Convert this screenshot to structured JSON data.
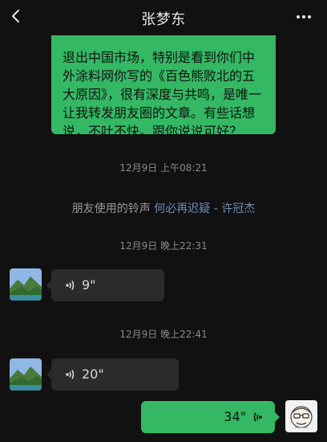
{
  "header": {
    "title": "张梦东",
    "back_icon": "chevron-left-icon",
    "more_icon": "more-horizontal-icon"
  },
  "messages": {
    "outgoing_text": "退出中国市场，特别是看到你们中外涂料网你写的《百色熊败北的五大原因》，很有深度与共鸣，是唯一让我转发朋友圈的文章。有些话想说，不吐不快。跟你说说可好？",
    "time1": "12月9日 上午08:21",
    "system": {
      "prefix": "朋友使用的铃声",
      "link": "何必再迟疑 - 许冠杰"
    },
    "time2": "12月9日 晚上22:31",
    "voice1": {
      "duration": "9\"",
      "icon": "voice-wave-icon"
    },
    "time3": "12月9日 晚上22:41",
    "voice2": {
      "duration": "20\"",
      "icon": "voice-wave-icon"
    },
    "voice3": {
      "duration": "34\"",
      "icon": "voice-wave-icon"
    }
  },
  "colors": {
    "background": "#111111",
    "bubble_green": "#34b864",
    "bubble_dark": "#2b2b2b",
    "link_blue": "#6f8cb7"
  }
}
